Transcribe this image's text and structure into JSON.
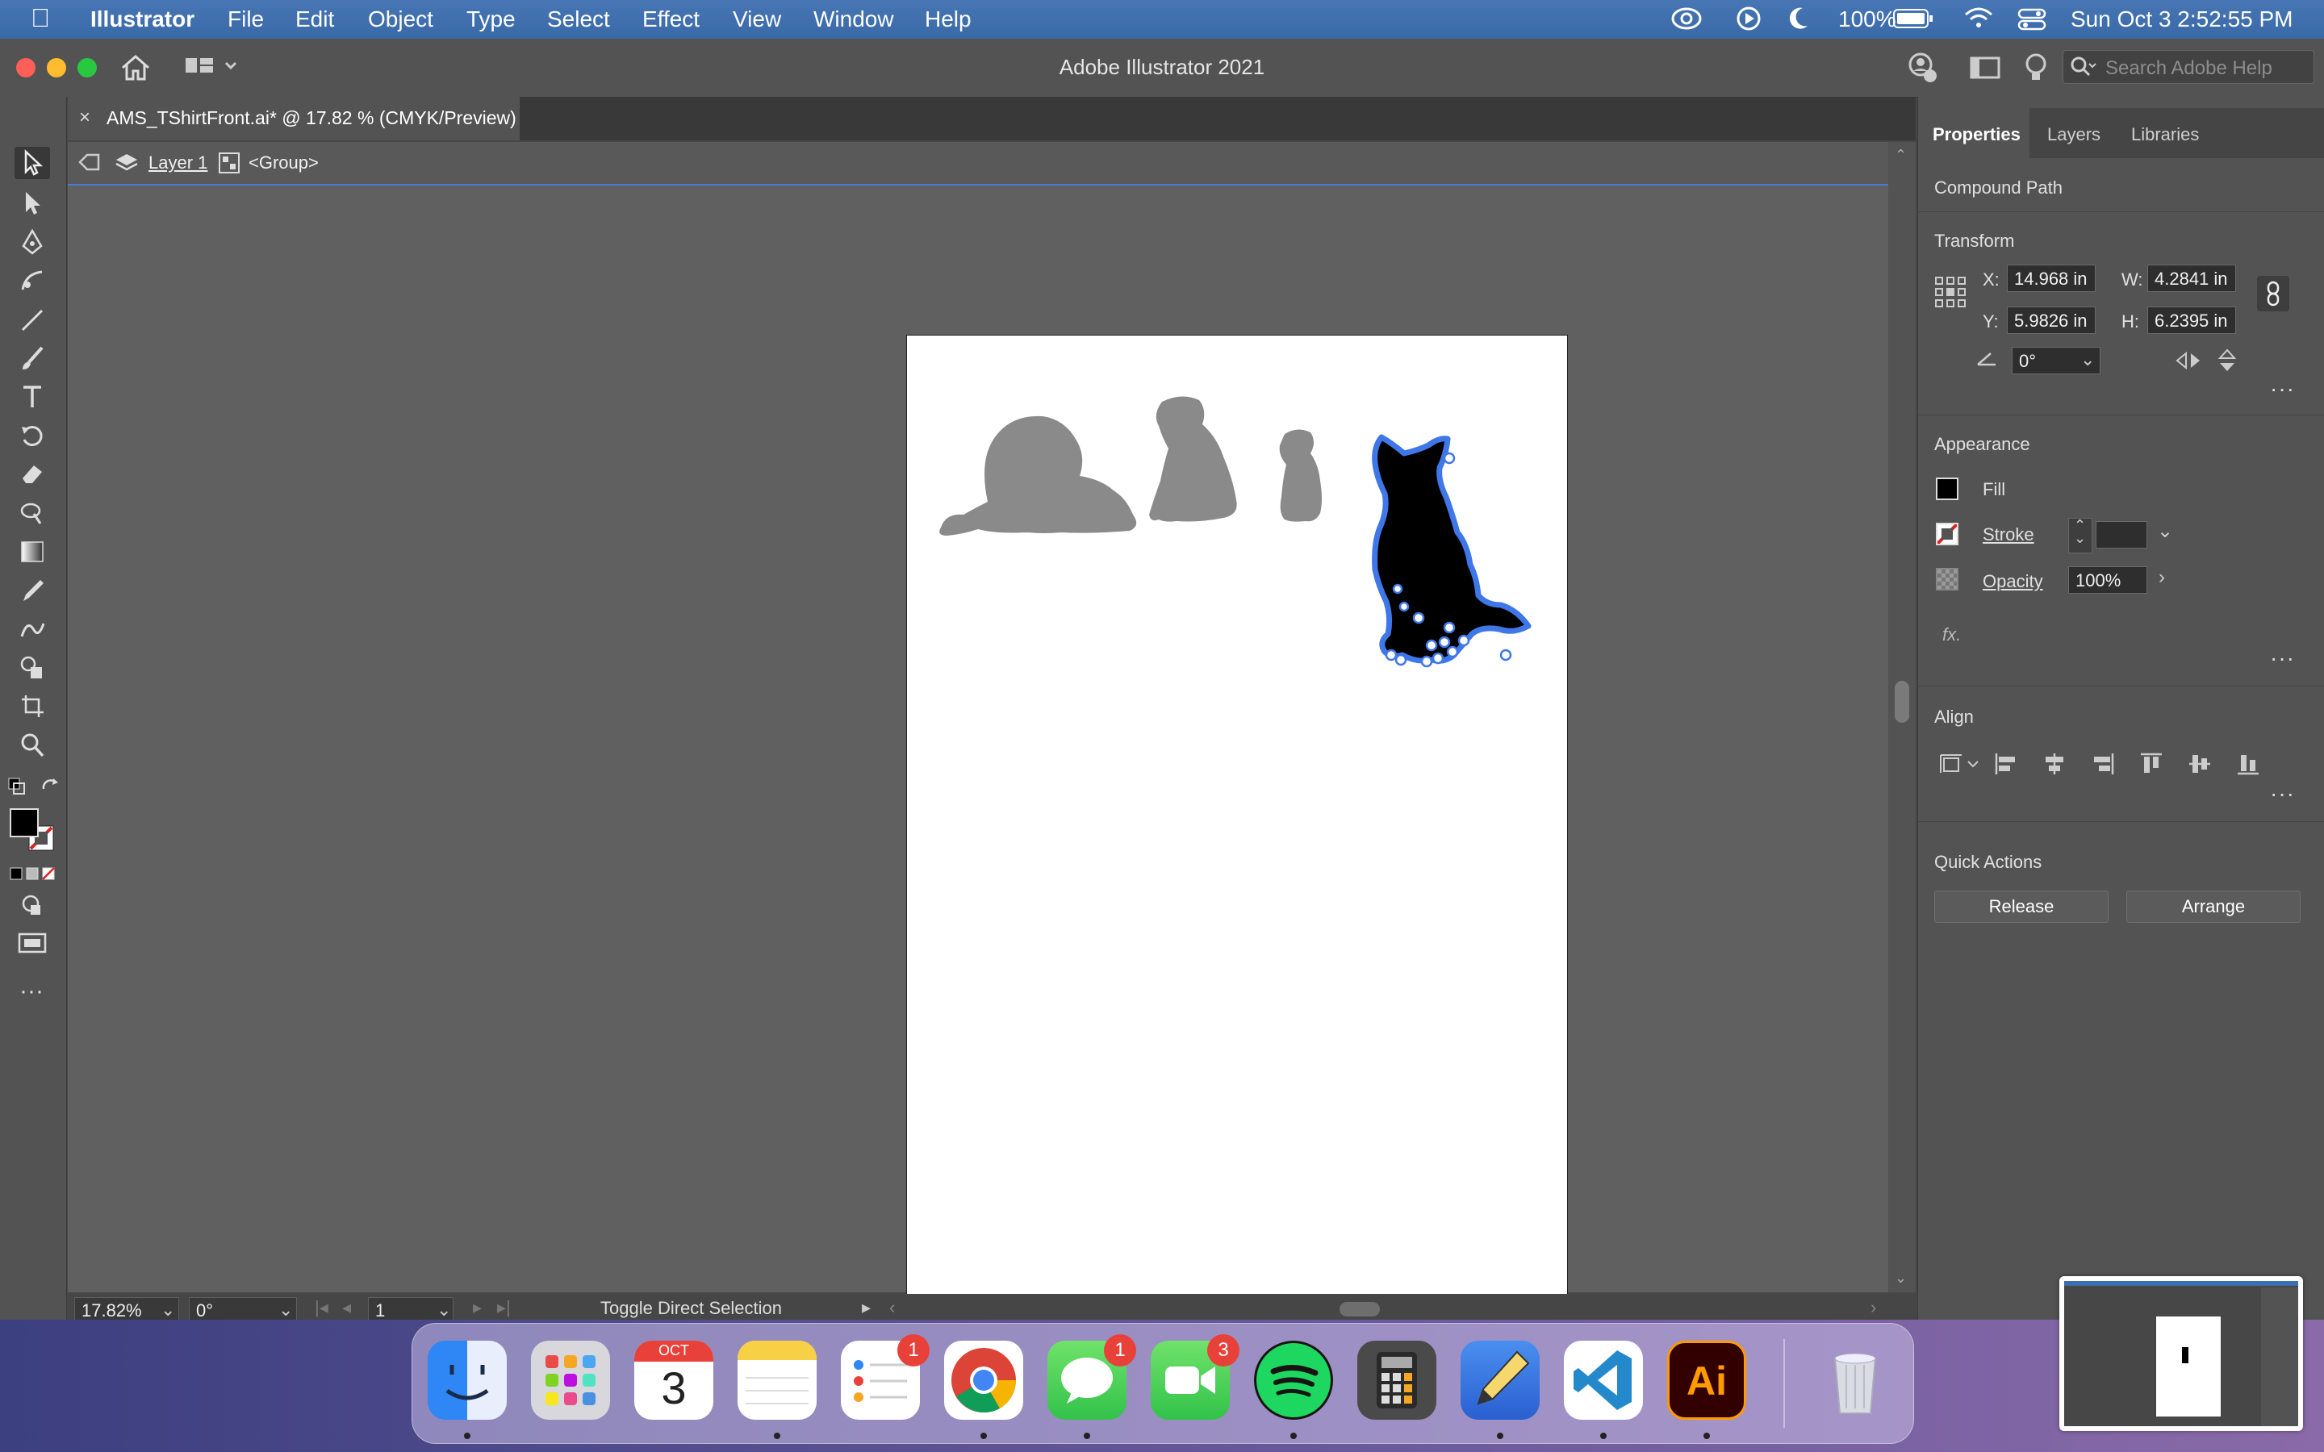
{
  "menubar": {
    "app_name": "Illustrator",
    "items": [
      "File",
      "Edit",
      "Object",
      "Type",
      "Select",
      "Effect",
      "View",
      "Window",
      "Help"
    ],
    "battery": "100%",
    "datetime": "Sun Oct 3  2:52:55 PM"
  },
  "window": {
    "title": "Adobe Illustrator 2021",
    "search_placeholder": "Search Adobe Help"
  },
  "document": {
    "tab_label": "AMS_TShirtFront.ai* @ 17.82 % (CMYK/Preview)",
    "breadcrumb_layer": "Layer 1",
    "breadcrumb_group": "<Group>"
  },
  "status": {
    "zoom": "17.82%",
    "rotation": "0°",
    "artboard": "1",
    "info": "Toggle Direct Selection"
  },
  "panel": {
    "tabs": [
      "Properties",
      "Layers",
      "Libraries"
    ],
    "object_type": "Compound Path",
    "transform": {
      "title": "Transform",
      "x_label": "X:",
      "x": "14.968 in",
      "y_label": "Y:",
      "y": "5.9826 in",
      "w_label": "W:",
      "w": "4.2841 in",
      "h_label": "H:",
      "h": "6.2395 in",
      "angle": "0°"
    },
    "appearance": {
      "title": "Appearance",
      "fill": "Fill",
      "stroke": "Stroke",
      "opacity_label": "Opacity",
      "opacity": "100%",
      "fx": "fx."
    },
    "align": {
      "title": "Align"
    },
    "quick_actions": {
      "title": "Quick Actions",
      "release": "Release",
      "arrange": "Arrange"
    }
  },
  "dock": {
    "calendar_month": "OCT",
    "calendar_day": "3",
    "reminders_badge": "1",
    "messages_badge": "1",
    "facetime_badge": "3",
    "illustrator_label": "Ai"
  },
  "colors": {
    "menubar": "#3d6fb0",
    "selection_blue": "#4a79d8",
    "silhouette_gray": "#8a8a8a",
    "selected_fill": "#000000"
  }
}
